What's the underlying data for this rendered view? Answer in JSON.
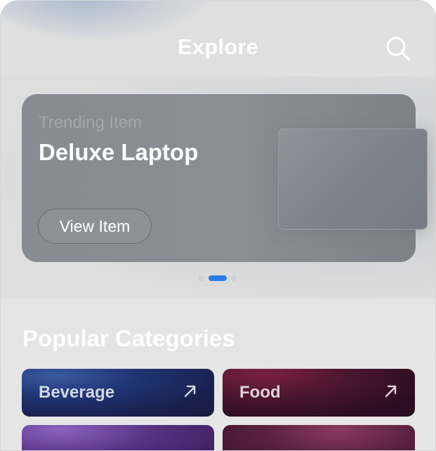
{
  "header": {
    "title": "Explore"
  },
  "hero": {
    "subtitle": "Trending Item",
    "title": "Deluxe Laptop",
    "button_label": "View Item"
  },
  "carousel": {
    "total": 3,
    "active_index": 1
  },
  "categories": {
    "title": "Popular Categories",
    "items": [
      {
        "label": "Beverage",
        "icon": "arrow-up-right-icon"
      },
      {
        "label": "Food",
        "icon": "arrow-up-right-icon"
      }
    ]
  },
  "colors": {
    "accent": "#2a7de1",
    "beverage_card": "#1f3574",
    "food_card": "#4a1530"
  }
}
